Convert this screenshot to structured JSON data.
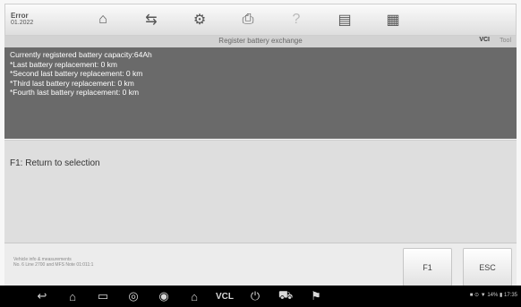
{
  "toolbar": {
    "time": "Error",
    "time_sub": "01.2022",
    "icons": [
      "home-icon",
      "vehicle-swap-icon",
      "settings-icon",
      "print-icon",
      "help-icon",
      "save-icon",
      "data-logging-icon"
    ]
  },
  "titlebar": {
    "title": "Register battery exchange",
    "vci": "VCI",
    "battery": "Tool"
  },
  "info": {
    "lines": [
      "Currently registered battery capacity:64Ah",
      "*Last battery replacement: 0 km",
      "*Second last battery replacement: 0 km",
      "*Third last battery replacement: 0 km",
      "*Fourth last battery replacement: 0 km"
    ]
  },
  "content": {
    "message": "F1: Return to selection"
  },
  "bottom": {
    "vehicle_info_line1": "Vehicle info & measurements",
    "vehicle_info_line2": "No. 6 Line 2700 and MFS Note 01:011:1"
  },
  "buttons": {
    "f1": "F1",
    "esc": "ESC"
  },
  "navbar": {
    "icons": [
      "back-icon",
      "home-icon",
      "recent-apps-icon",
      "chrome-icon",
      "game-icon",
      "car-home-icon",
      "vcl-label",
      "power-icon",
      "car-icon",
      "shop-icon"
    ],
    "vcl_label": "VCL",
    "status": "■ ⊙ ▼ 14% ▮ 17:35"
  }
}
